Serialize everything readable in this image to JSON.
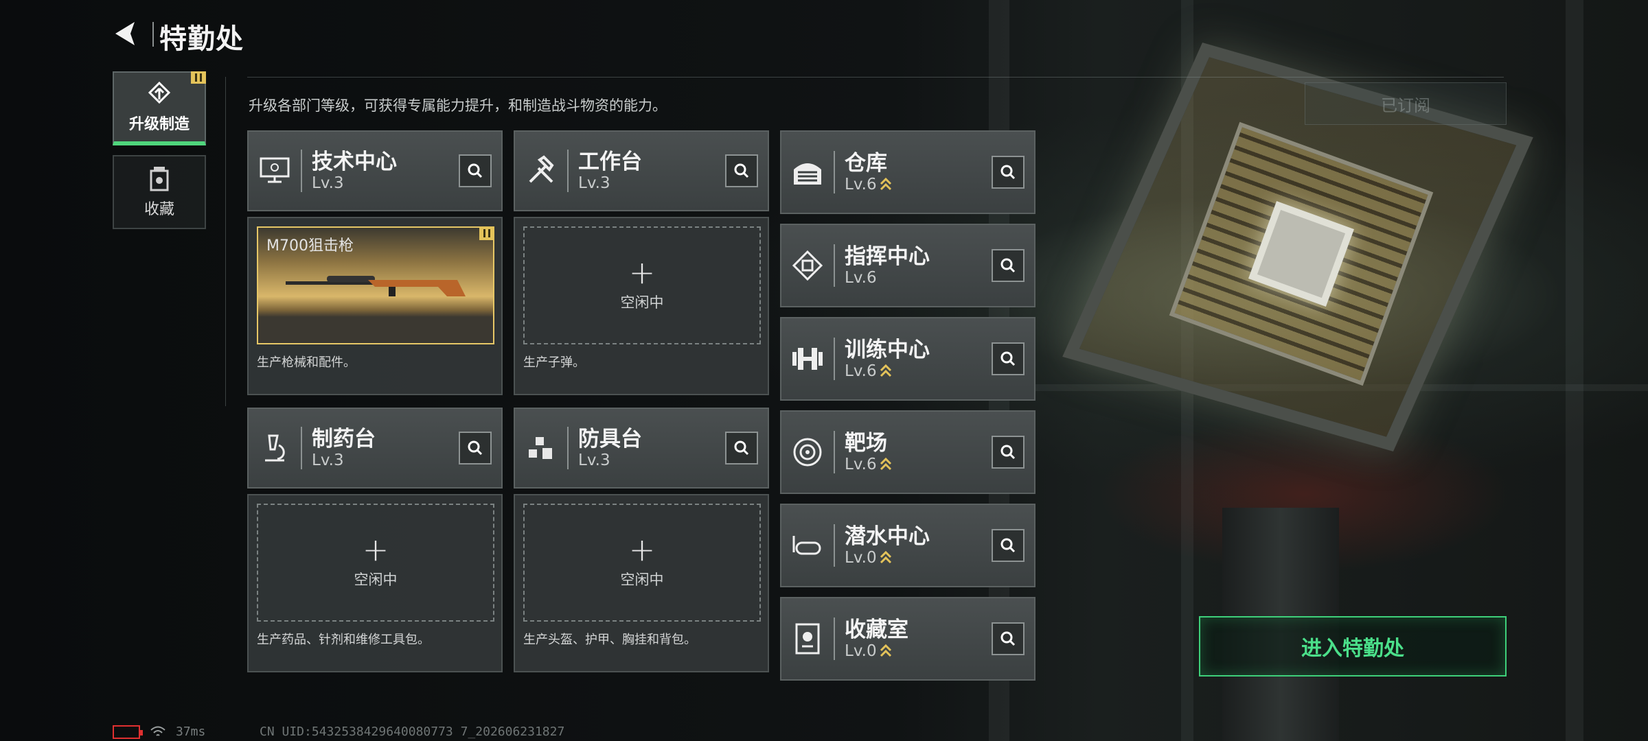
{
  "header": {
    "title": "特勤处"
  },
  "sidebar": {
    "tabs": [
      {
        "label": "升级制造",
        "active": true
      },
      {
        "label": "收藏",
        "active": false
      }
    ]
  },
  "subtitle": "升级各部门等级，可获得专属能力提升，和制造战斗物资的能力。",
  "departments": {
    "tech_center": {
      "name": "技术中心",
      "level": "Lv.3"
    },
    "workbench": {
      "name": "工作台",
      "level": "Lv.3"
    },
    "pharmacy": {
      "name": "制药台",
      "level": "Lv.3"
    },
    "armor": {
      "name": "防具台",
      "level": "Lv.3"
    },
    "warehouse": {
      "name": "仓库",
      "level": "Lv.6"
    },
    "command": {
      "name": "指挥中心",
      "level": "Lv.6"
    },
    "training": {
      "name": "训练中心",
      "level": "Lv.6"
    },
    "range": {
      "name": "靶场",
      "level": "Lv.6"
    },
    "diving": {
      "name": "潜水中心",
      "level": "Lv.0"
    },
    "collection": {
      "name": "收藏室",
      "level": "Lv.0"
    }
  },
  "panels": {
    "tech_center": {
      "item": "M700狙击枪",
      "desc": "生产枪械和配件。"
    },
    "workbench": {
      "status": "空闲中",
      "desc": "生产子弹。"
    },
    "pharmacy": {
      "status": "空闲中",
      "desc": "生产药品、针剂和维修工具包。"
    },
    "armor": {
      "status": "空闲中",
      "desc": "生产头盔、护甲、胸挂和背包。"
    }
  },
  "ghost_button": "已订阅",
  "enter_button": "进入特勤处",
  "status": {
    "ping": "37ms",
    "uid": "CN UID:5432538429640080773 7_202606231827"
  },
  "colors": {
    "accent": "#4be08a",
    "notice": "#e4c35a",
    "upgrade_arrow": "#e4c35a"
  }
}
